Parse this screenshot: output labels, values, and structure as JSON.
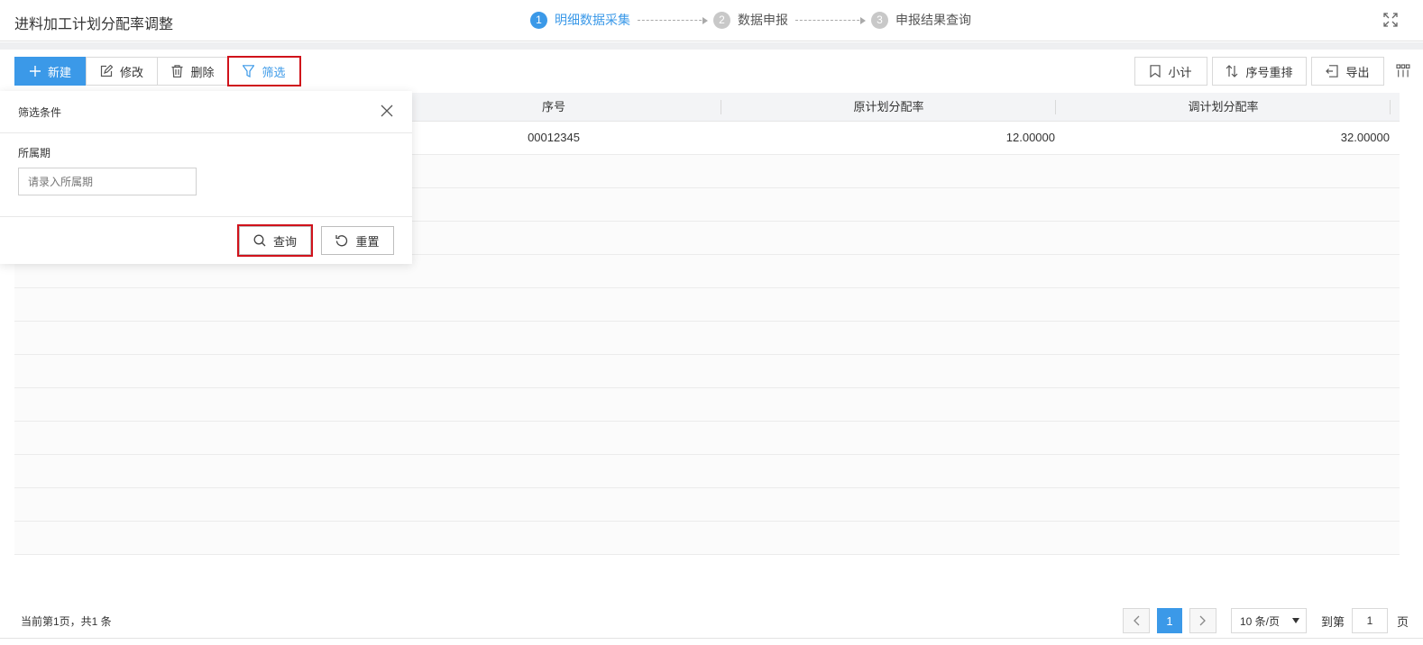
{
  "app": {
    "title": "进料加工计划分配率调整"
  },
  "steps": [
    {
      "num": "1",
      "label": "明细数据采集",
      "active": true
    },
    {
      "num": "2",
      "label": "数据申报",
      "active": false
    },
    {
      "num": "3",
      "label": "申报结果查询",
      "active": false
    }
  ],
  "toolbar": {
    "new_label": "新建",
    "edit_label": "修改",
    "delete_label": "删除",
    "filter_label": "筛选",
    "subtotal_label": "小计",
    "reorder_label": "序号重排",
    "export_label": "导出"
  },
  "table": {
    "columns": [
      "",
      "序号",
      "原计划分配率",
      "调计划分配率"
    ],
    "rows": [
      {
        "seq": "00012345",
        "original_rate": "12.00000",
        "adjusted_rate": "32.00000"
      }
    ]
  },
  "filter": {
    "title": "筛选条件",
    "field_label": "所属期",
    "field_placeholder": "请录入所属期",
    "field_value": "",
    "query_label": "查询",
    "reset_label": "重置"
  },
  "pagination": {
    "info": "当前第1页，共1 条",
    "current_page": "1",
    "page_size": "10 条/页",
    "goto_label": "到第",
    "goto_value": "1",
    "page_suffix": "页"
  },
  "colors": {
    "accent": "#3b99e8",
    "highlight_border": "#d0121b",
    "header_bg": "#f3f4f6"
  },
  "icons": [
    "plus-icon",
    "edit-icon",
    "trash-icon",
    "funnel-icon",
    "bookmark-icon",
    "sort-icon",
    "export-icon",
    "grid-icon",
    "fullscreen-icon",
    "close-icon",
    "search-icon",
    "reset-icon",
    "chevron-left-icon",
    "chevron-right-icon"
  ]
}
